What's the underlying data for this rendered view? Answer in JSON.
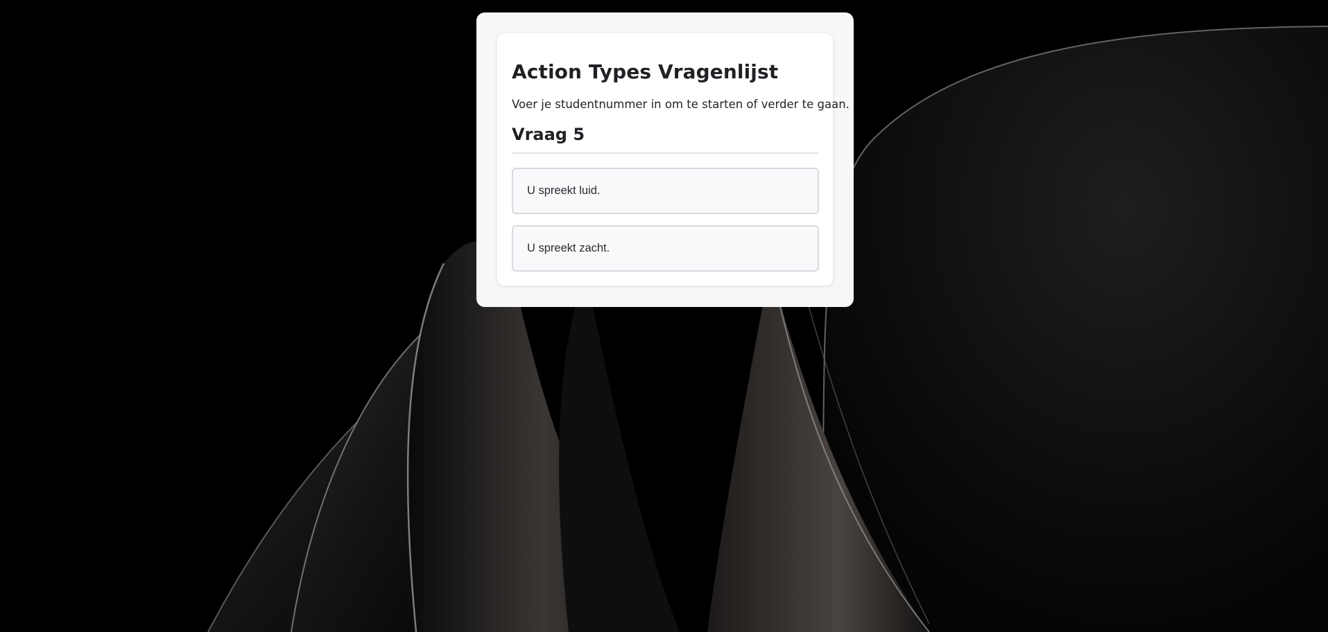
{
  "questionnaire": {
    "title": "Action Types Vragenlijst",
    "subtitle": "Voer je studentnummer in om te starten of verder te gaan.",
    "question_title": "Vraag 5",
    "options": [
      {
        "label": "U spreekt luid."
      },
      {
        "label": "U spreekt zacht."
      }
    ]
  },
  "colors": {
    "background": "#000000",
    "card": "#ffffff",
    "option_background": "#f8f9fa",
    "option_border": "#d9dadd",
    "text": "#1f2125"
  },
  "icons": {
    "background": "abstract-dark-wallpaper"
  }
}
